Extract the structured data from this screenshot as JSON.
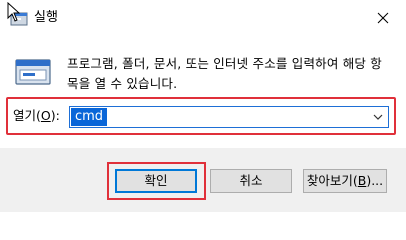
{
  "window": {
    "title": "실행",
    "icon": "run-app-icon",
    "close_icon": "close-icon"
  },
  "body": {
    "icon": "run-icon",
    "description_line1": "프로그램, 폴더, 문서, 또는 인터넷 주소를 입력하여 해당 항",
    "description_line2": "목을 열 수 있습니다."
  },
  "open_field": {
    "label_prefix": "열기(",
    "label_accel": "O",
    "label_suffix": "):",
    "value": "cmd"
  },
  "buttons": {
    "ok_label": "확인",
    "cancel_label": "취소",
    "browse_prefix": "찾아보기(",
    "browse_accel": "B",
    "browse_suffix": ")..."
  },
  "colors": {
    "highlight_red": "#e0303a",
    "focus_blue": "#0078d7",
    "selection_blue": "#0a66d8"
  }
}
